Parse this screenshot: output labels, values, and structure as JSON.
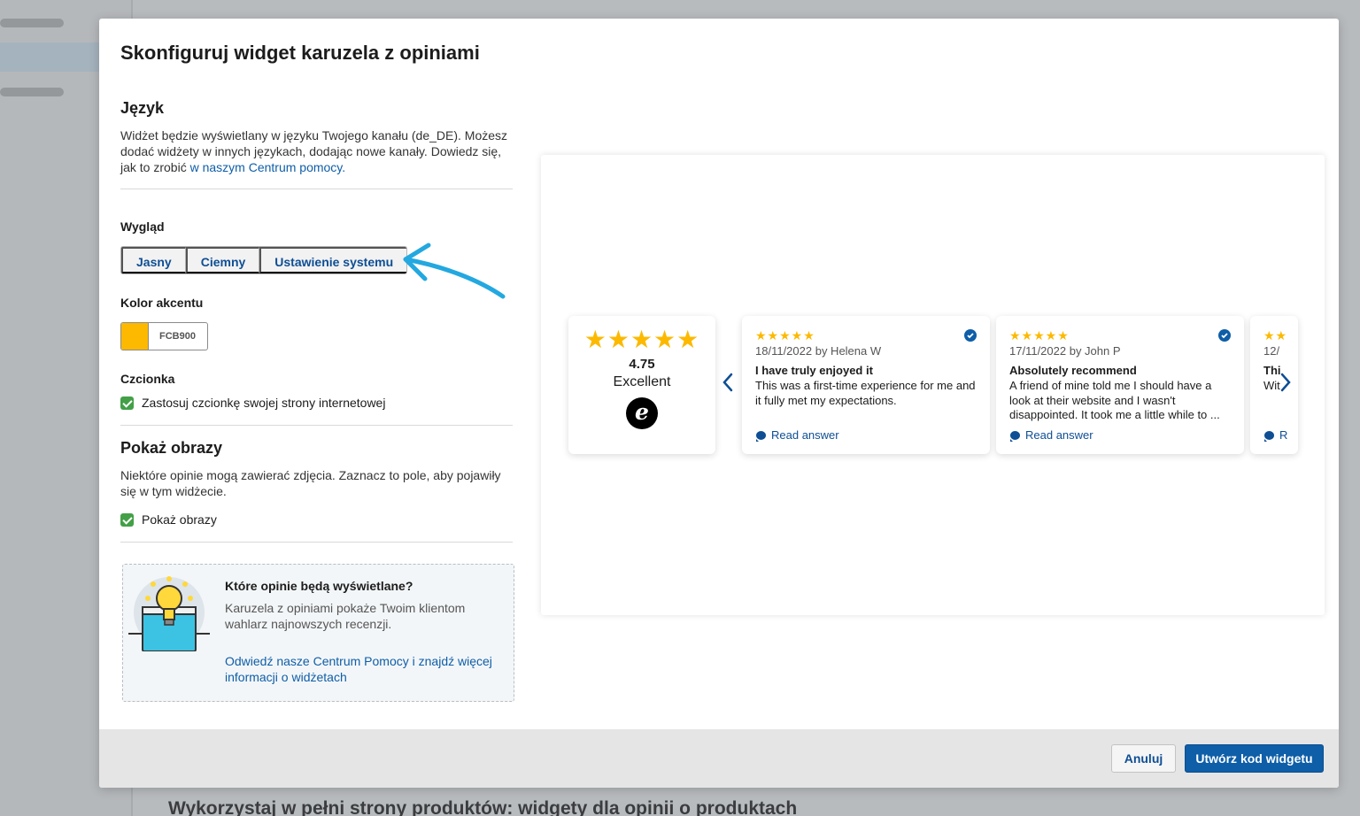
{
  "background": {
    "heading": "Wykorzystaj w pełni strony produktów: widgety dla opinii o produktach"
  },
  "modal": {
    "title": "Skonfiguruj widget karuzela z opiniami",
    "language": {
      "heading": "Język",
      "text": "Widżet będzie wyświetlany w języku Twojego kanału (de_DE). Możesz dodać widżety w innych językach, dodając nowe kanały. Dowiedz się, jak to zrobić ",
      "link": "w naszym Centrum pomocy."
    },
    "appearance": {
      "label": "Wygląd",
      "options": [
        "Jasny",
        "Ciemny",
        "Ustawienie systemu"
      ]
    },
    "accent": {
      "label": "Kolor akcentu",
      "value": "FCB900",
      "color": "#FCB900"
    },
    "font": {
      "label": "Czcionka",
      "checkbox_label": "Zastosuj czcionkę swojej strony internetowej",
      "checked": true
    },
    "images": {
      "heading": "Pokaż obrazy",
      "text": "Niektóre opinie mogą zawierać zdjęcia. Zaznacz to pole, aby pojawiły się w tym widżecie.",
      "checkbox_label": "Pokaż obrazy",
      "checked": true
    },
    "info": {
      "title": "Które opinie będą wyświetlane?",
      "text": "Karuzela z opiniami pokaże Twoim klientom wahlarz najnowszych recenzji.",
      "link": "Odwiedź nasze Centrum Pomocy i znajdź więcej informacji o widżetach"
    },
    "preview": {
      "summary": {
        "stars": "★★★★★",
        "rating": "4.75",
        "label": "Excellent",
        "logo_letter": "e"
      },
      "reviews": [
        {
          "stars": "★★★★★",
          "meta": "18/11/2022 by Helena W",
          "title": "I have truly enjoyed it",
          "body": "This was a first-time experience for me and it fully met my expectations.",
          "answer": "Read answer"
        },
        {
          "stars": "★★★★★",
          "meta": "17/11/2022 by John P",
          "title": "Absolutely recommend",
          "body": "A friend of mine told me I should have a look at their website and I wasn't disappointed. It took me a little while to ...",
          "answer": "Read answer"
        },
        {
          "stars": "★★",
          "meta": "12/",
          "title": "Thi",
          "body": "Wit",
          "answer": "R"
        }
      ]
    },
    "footer": {
      "cancel": "Anuluj",
      "create": "Utwórz kod widgetu"
    }
  }
}
